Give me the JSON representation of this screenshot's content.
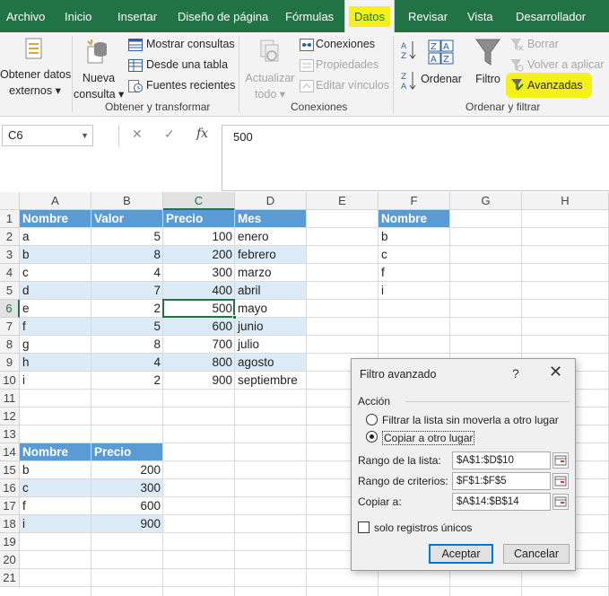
{
  "menu": {
    "tabs": [
      "Archivo",
      "Inicio",
      "Insertar",
      "Diseño de página",
      "Fórmulas",
      "Datos",
      "Revisar",
      "Vista",
      "Desarrollador"
    ],
    "active": "Datos"
  },
  "ribbon": {
    "obtener_datos": [
      "Obtener datos",
      "externos"
    ],
    "nueva_consulta": [
      "Nueva",
      "consulta"
    ],
    "mostrar_consultas": "Mostrar consultas",
    "desde_tabla": "Desde una tabla",
    "fuentes_recientes": "Fuentes recientes",
    "group1": "Obtener y transformar",
    "actualizar": [
      "Actualizar",
      "todo"
    ],
    "conexiones": "Conexiones",
    "propiedades": "Propiedades",
    "editar_vinculos": "Editar vínculos",
    "group2": "Conexiones",
    "ordenar": "Ordenar",
    "filtro": "Filtro",
    "borrar": "Borrar",
    "volver_aplicar": "Volver a aplicar",
    "avanzadas": "Avanzadas",
    "group3": "Ordenar y filtrar",
    "highlight_color": "#f4f11a"
  },
  "formula_bar": {
    "name_box": "C6",
    "value": "500",
    "cancel_icon": "✕",
    "enter_icon": "✓",
    "fx": "fx"
  },
  "sheet": {
    "columns": [
      "A",
      "B",
      "C",
      "D",
      "E",
      "F",
      "G",
      "H"
    ],
    "rows": [
      "1",
      "2",
      "3",
      "4",
      "5",
      "6",
      "7",
      "8",
      "9",
      "10",
      "11",
      "12",
      "13",
      "14",
      "15",
      "16",
      "17",
      "18",
      "19",
      "20",
      "21"
    ],
    "selected_col": "C",
    "selected_row": "6",
    "table1": {
      "headers": [
        "Nombre",
        "Valor",
        "Precio",
        "Mes"
      ],
      "rows": [
        [
          "a",
          "5",
          "100",
          "enero"
        ],
        [
          "b",
          "8",
          "200",
          "febrero"
        ],
        [
          "c",
          "4",
          "300",
          "marzo"
        ],
        [
          "d",
          "7",
          "400",
          "abril"
        ],
        [
          "e",
          "2",
          "500",
          "mayo"
        ],
        [
          "f",
          "5",
          "600",
          "junio"
        ],
        [
          "g",
          "8",
          "700",
          "julio"
        ],
        [
          "h",
          "4",
          "800",
          "agosto"
        ],
        [
          "i",
          "2",
          "900",
          "septiembre"
        ]
      ]
    },
    "criteria": {
      "header": "Nombre",
      "values": [
        "b",
        "c",
        "f",
        "i"
      ]
    },
    "output": {
      "headers": [
        "Nombre",
        "Precio"
      ],
      "rows": [
        [
          "b",
          "200"
        ],
        [
          "c",
          "300"
        ],
        [
          "f",
          "600"
        ],
        [
          "i",
          "900"
        ]
      ]
    },
    "header_fill": "#5b9bd5",
    "band_fill": "#ddebf7"
  },
  "dialog": {
    "title": "Filtro avanzado",
    "help": "?",
    "close": "✕",
    "section": "Acción",
    "option1": "Filtrar la lista sin moverla a otro lugar",
    "option2": "Copiar a otro lugar",
    "selected_option": "option2",
    "rango_lista_label": "Rango de la lista:",
    "rango_lista": "$A$1:$D$10",
    "rango_criterios_label": "Rango de criterios:",
    "rango_criterios": "$F$1:$F$5",
    "copiar_label": "Copiar a:",
    "copiar": "$A$14:$B$14",
    "unicos_label": "solo registros únicos",
    "unicos_checked": false,
    "aceptar": "Aceptar",
    "cancelar": "Cancelar"
  }
}
